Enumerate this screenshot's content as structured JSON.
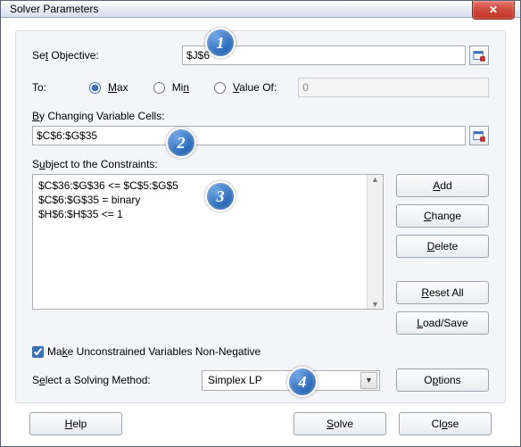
{
  "window": {
    "title": "Solver Parameters"
  },
  "objective": {
    "label_pre": "Se",
    "label_u": "t",
    "label_post": " Objective:",
    "value": "$J$6"
  },
  "to": {
    "label": "To:",
    "max_u": "M",
    "max_post": "ax",
    "min_pre": "Mi",
    "min_u": "n",
    "val_u": "V",
    "val_post": "alue Of:",
    "selected": "max",
    "value_of_text": "0"
  },
  "changing": {
    "label_u": "B",
    "label_post": "y Changing Variable Cells:",
    "value": "$C$6:$G$35"
  },
  "constraints": {
    "label_pre": "S",
    "label_u": "u",
    "label_post": "bject to the Constraints:",
    "items": [
      "$C$36:$G$36 <= $C$5:$G$5",
      "$C$6:$G$35 = binary",
      "$H$6:$H$35 <= 1"
    ]
  },
  "buttons": {
    "add_u": "A",
    "add_post": "dd",
    "change_u": "C",
    "change_post": "hange",
    "delete_u": "D",
    "delete_post": "elete",
    "reset_u": "R",
    "reset_post": "eset All",
    "load_u": "L",
    "load_post": "oad/Save",
    "options_pre": "O",
    "options_u": "p",
    "options_post": "tions",
    "help_u": "H",
    "help_post": "elp",
    "solve_u": "S",
    "solve_post": "olve",
    "close_pre": "Cl",
    "close_u": "o",
    "close_post": "se"
  },
  "nonneg": {
    "label_pre": "Ma",
    "label_u": "k",
    "label_post": "e Unconstrained Variables Non-Negative",
    "checked": true
  },
  "method": {
    "label_pre": "S",
    "label_u": "e",
    "label_post": "lect a Solving Method:",
    "selected": "Simplex LP"
  },
  "callouts": {
    "c1": "1",
    "c2": "2",
    "c3": "3",
    "c4": "4"
  }
}
